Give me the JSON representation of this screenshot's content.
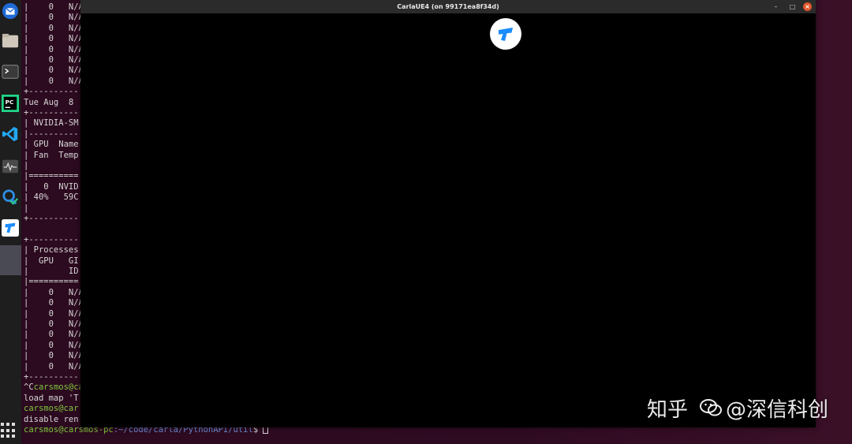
{
  "window": {
    "title": "CarlaUE4  (on 99171ea8f34d)",
    "buttons": {
      "minimize": "–",
      "maximize": "□",
      "close": "×"
    }
  },
  "dock": {
    "items": [
      {
        "name": "thunderbird-mail-icon",
        "color": "#1f6ad6"
      },
      {
        "name": "files-folder-icon",
        "color": "#d6d0c4"
      },
      {
        "name": "terminal-icon",
        "color": "#3a3a3a"
      },
      {
        "name": "pycharm-icon",
        "color": "#21d789"
      },
      {
        "name": "vscode-icon",
        "color": "#23a8f2"
      },
      {
        "name": "system-monitor-icon",
        "color": "#5a5a5a"
      },
      {
        "name": "network-app-icon",
        "color": "#2f8de4"
      },
      {
        "name": "todesk-icon",
        "color": "#1a8cff"
      }
    ]
  },
  "terminal": {
    "lines": [
      "|    0   N/A",
      "|    0   N/A",
      "|    0   N/A",
      "|    0   N/A",
      "|    0   N/A",
      "|    0   N/A",
      "|    0   N/A",
      "|    0   N/A",
      "+----------",
      "Tue Aug  8",
      "+----------",
      "| NVIDIA-SM",
      "|----------",
      "| GPU  Name",
      "| Fan  Temp",
      "|          ",
      "|==========",
      "|   0  NVID",
      "| 40%   59C",
      "|          ",
      "+----------",
      "",
      "+----------",
      "| Processes",
      "|  GPU   GI",
      "|        ID",
      "|==========",
      "|    0   N/A",
      "|    0   N/A",
      "|    0   N/A",
      "|    0   N/A",
      "|    0   N/A",
      "|    0   N/A",
      "|    0   N/A",
      "|    0   N/A",
      "+----------"
    ],
    "tail": [
      {
        "pre": "^C",
        "user": "carsmos@ca",
        "path": "",
        "rest": ""
      },
      {
        "pre": "load map 'T",
        "user": "",
        "path": "",
        "rest": ""
      },
      {
        "pre": "",
        "user": "carsmos@car",
        "path": "",
        "rest": ""
      },
      {
        "pre": "disable ren",
        "user": "",
        "path": "",
        "rest": ""
      },
      {
        "pre": "",
        "user": "carsmos@carsmos-pc",
        "path": ":~/code/carla/PythonAPI/util",
        "rest": "$ "
      }
    ]
  },
  "watermark": {
    "site": "知乎",
    "author": "@深信科创"
  },
  "colors": {
    "terminal_bg": "#2c0a1f",
    "prompt_user": "#7ec73d",
    "prompt_path": "#6c8cd5",
    "titlebar": "#2b2b2b",
    "close_button": "#e0552b"
  }
}
